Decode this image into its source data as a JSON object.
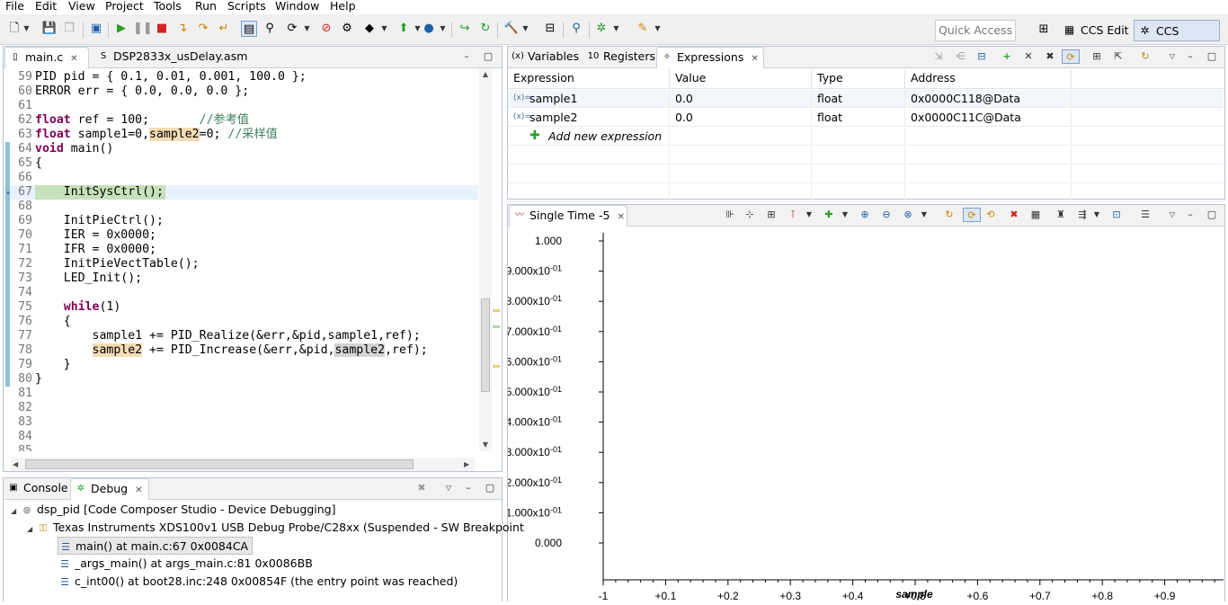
{
  "menu": [
    "File",
    "Edit",
    "View",
    "Project",
    "Tools",
    "Run",
    "Scripts",
    "Window",
    "Help"
  ],
  "toolbar": {
    "quick_access": "Quick Access",
    "perspective_edit": "CCS Edit",
    "perspective_debug": "CCS Debug"
  },
  "editor": {
    "tabs": [
      {
        "label": "main.c",
        "icon": "c-file-icon"
      },
      {
        "label": "DSP2833x_usDelay.asm",
        "icon": "asm-file-icon"
      }
    ],
    "lines": [
      {
        "n": "59",
        "text": "PID pid = { 0.1, 0.01, 0.001, 100.0 };"
      },
      {
        "n": "60",
        "text": "ERROR err = { 0.0, 0.0, 0.0 };"
      },
      {
        "n": "61",
        "text": ""
      },
      {
        "n": "62",
        "kw": "float",
        "text": " ref = 100;       ",
        "comment": "//参考值"
      },
      {
        "n": "63",
        "kw": "float",
        "text1": " sample1=0,",
        "hl": "sample2",
        "text2": "=0; ",
        "comment": "//采样值"
      },
      {
        "n": "64",
        "kw": "void",
        "text": " main()"
      },
      {
        "n": "65",
        "text": "{"
      },
      {
        "n": "66",
        "text": ""
      },
      {
        "n": "67",
        "text": "    InitSysCtrl();"
      },
      {
        "n": "68",
        "text": ""
      },
      {
        "n": "69",
        "text": "    InitPieCtrl();"
      },
      {
        "n": "70",
        "text": "    IER = 0x0000;"
      },
      {
        "n": "71",
        "text": "    IFR = 0x0000;"
      },
      {
        "n": "72",
        "text": "    InitPieVectTable();"
      },
      {
        "n": "73",
        "text": "    LED_Init();"
      },
      {
        "n": "74",
        "text": ""
      },
      {
        "n": "75",
        "kw": "while",
        "pre": "    ",
        "text": "(1)"
      },
      {
        "n": "76",
        "text": "    {"
      },
      {
        "n": "77",
        "text": "        sample1 += PID_Realize(&err,&pid,sample1,ref);"
      },
      {
        "n": "78",
        "hl": "sample2",
        "pre": "        ",
        "text1": " += PID_Increase(&err,&pid,",
        "hl2": "sample2",
        "text2": ",ref);"
      },
      {
        "n": "79",
        "text": "    }"
      },
      {
        "n": "80",
        "text": "}"
      },
      {
        "n": "81",
        "text": ""
      },
      {
        "n": "82",
        "text": ""
      },
      {
        "n": "83",
        "text": ""
      },
      {
        "n": "84",
        "text": ""
      },
      {
        "n": "85",
        "text": ""
      }
    ]
  },
  "views": {
    "tabs": [
      {
        "label": "Variables",
        "icon": "variables-icon"
      },
      {
        "label": "Registers",
        "icon": "registers-icon"
      },
      {
        "label": "Expressions",
        "icon": "expressions-icon"
      }
    ],
    "columns": [
      "Expression",
      "Value",
      "Type",
      "Address"
    ],
    "rows": [
      {
        "expression": "sample1",
        "value": "0.0",
        "type": "float",
        "address": "0x0000C118@Data"
      },
      {
        "expression": "sample2",
        "value": "0.0",
        "type": "float",
        "address": "0x0000C11C@Data"
      }
    ],
    "add_new": "Add new expression"
  },
  "debug": {
    "tabs": [
      {
        "label": "Console",
        "icon": "console-icon"
      },
      {
        "label": "Debug",
        "icon": "debug-icon"
      }
    ],
    "tree": [
      {
        "label": "dsp_pid [Code Composer Studio - Device Debugging]",
        "level": 0,
        "icon": "target-icon"
      },
      {
        "label": "Texas Instruments XDS100v1 USB Debug Probe/C28xx (Suspended - SW Breakpoint",
        "level": 1,
        "icon": "probe-icon"
      },
      {
        "label": "main() at main.c:67 0x0084CA",
        "level": 2,
        "icon": "stack-frame-icon",
        "selected": true
      },
      {
        "label": "_args_main() at args_main.c:81 0x0086BB",
        "level": 2,
        "icon": "stack-frame-icon"
      },
      {
        "label": "c_int00() at boot28.inc:248 0x00854F  (the entry point was reached)",
        "level": 2,
        "icon": "stack-frame-icon"
      }
    ]
  },
  "graph": {
    "tab": "Single Time -5",
    "chart_data": {
      "type": "line",
      "xlabel": "sample",
      "ylabel": "",
      "xlim": [
        -1,
        1
      ],
      "ylim": [
        0,
        1
      ],
      "y_ticks": [
        "1.000",
        "9.000x10-01",
        "8.000x10-01",
        "7.000x10-01",
        "6.000x10-01",
        "5.000x10-01",
        "4.000x10-01",
        "3.000x10-01",
        "2.000x10-01",
        "1.000x10-01",
        "0.000"
      ],
      "x_ticks": [
        "-1",
        "+0.1",
        "+0.2",
        "+0.3",
        "+0.4",
        "+0.5",
        "+0.6",
        "+0.7",
        "+0.8",
        "+0.9"
      ],
      "series": []
    }
  },
  "colors": {
    "keyword": "#7f0055",
    "comment": "#3f7f5f",
    "highlight": "#f5dcb4",
    "current_line": "#c7e1ba"
  }
}
